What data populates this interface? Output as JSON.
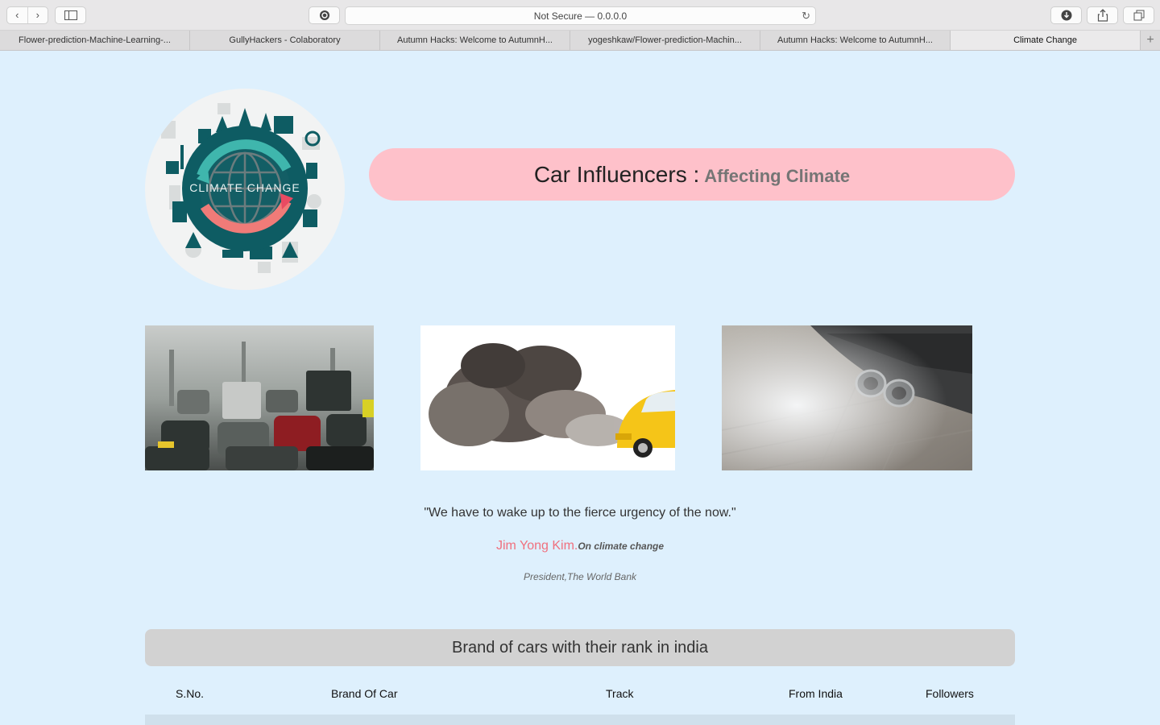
{
  "browser": {
    "address": "Not Secure — 0.0.0.0",
    "tabs": [
      "Flower-prediction-Machine-Learning-...",
      "GullyHackers - Colaboratory",
      "Autumn Hacks: Welcome to AutumnH...",
      "yogeshkaw/Flower-prediction-Machin...",
      "Autumn Hacks: Welcome to AutumnH...",
      "Climate Change"
    ],
    "active_tab": 5,
    "icons": [
      "back-icon",
      "forward-icon",
      "sidebar-icon",
      "reader-icon",
      "reload-icon",
      "download-icon",
      "share-icon",
      "tabs-icon",
      "new-tab-icon"
    ]
  },
  "page": {
    "logo_text": "CLIMATE CHANGE",
    "title_main": "Car Influencers : ",
    "title_sub": "Affecting Climate",
    "quote": "\"We have to wake up to the fierce urgency of the now.\"",
    "author_name": "Jim Yong Kim.",
    "author_note": "On climate change",
    "author_position": "President,The World Bank",
    "table_title": "Brand of cars with their rank in india",
    "table_headers": [
      "S.No.",
      "Brand Of Car",
      "Track",
      "From India",
      "Followers"
    ]
  },
  "colors": {
    "page_bg": "#def0fd",
    "title_pill": "#fec1ca",
    "author_accent": "#f0707e",
    "logo_teal": "#0e5c63"
  }
}
